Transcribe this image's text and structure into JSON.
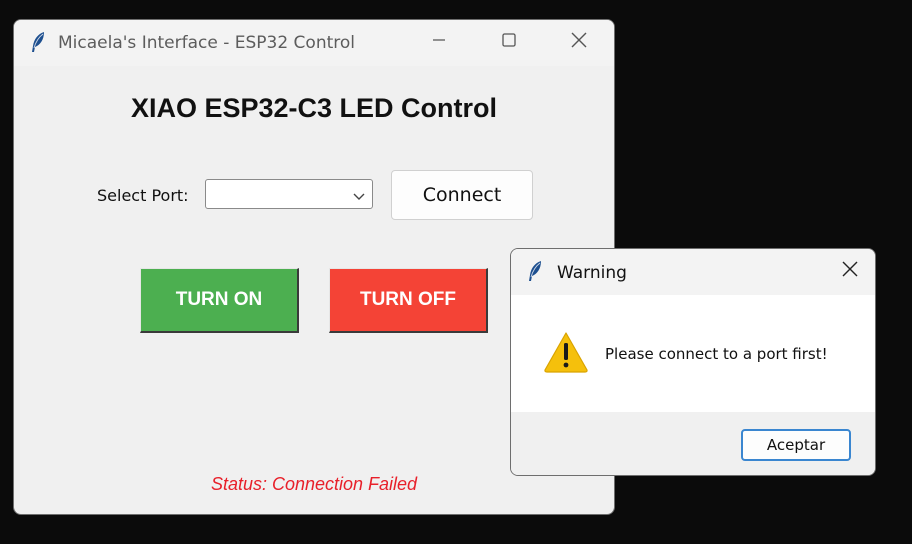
{
  "main_window": {
    "title": "Micaela's Interface - ESP32 Control",
    "heading": "XIAO ESP32-C3 LED Control",
    "port_label": "Select Port:",
    "port_value": "",
    "connect_label": "Connect",
    "turn_on_label": "TURN ON",
    "turn_off_label": "TURN OFF",
    "status_text": "Status: Connection Failed",
    "colors": {
      "turn_on": "#4caf50",
      "turn_off": "#f44336",
      "status": "#e8202a"
    }
  },
  "warning_dialog": {
    "title": "Warning",
    "message": "Please connect to a port first!",
    "ok_label": "Aceptar",
    "icon": "warning-triangle-icon"
  },
  "icons": {
    "app": "feather-icon",
    "minimize": "minimize-icon",
    "maximize": "maximize-icon",
    "close": "close-icon",
    "dropdown": "chevron-down-icon"
  }
}
